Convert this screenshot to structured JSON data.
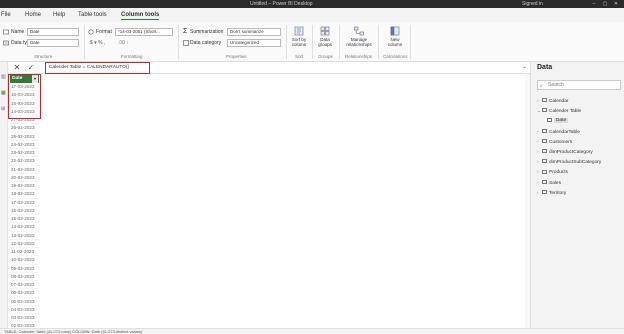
{
  "titlebar": {
    "title": "Untitled – Power BI Desktop",
    "user": "Signed in"
  },
  "menu": {
    "tabs": [
      {
        "label": "File"
      },
      {
        "label": "Home"
      },
      {
        "label": "Help"
      },
      {
        "label": "Table tools"
      },
      {
        "label": "Column tools",
        "active": true
      }
    ]
  },
  "ribbon": {
    "structure": {
      "name_label": "Name",
      "name_value": "Date",
      "datatype_label": "Data type",
      "datatype_value": "Date",
      "group_label": "Structure"
    },
    "formatting": {
      "format_label": "Format",
      "format_value": "*14-03-2001 (Short...",
      "group_label": "Formatting"
    },
    "properties": {
      "summarization_label": "Summarization",
      "summarization_value": "Don't summarize",
      "category_label": "Data category",
      "category_value": "Uncategorized",
      "group_label": "Properties"
    },
    "sort": {
      "label1": "Sort by",
      "label2": "column",
      "group_label": "Sort"
    },
    "groups": {
      "label1": "Data",
      "label2": "groups",
      "group_label": "Groups"
    },
    "relationships": {
      "label1": "Manage",
      "label2": "relationships",
      "group_label": "Relationships"
    },
    "calculations": {
      "label1": "New",
      "label2": "column",
      "group_label": "Calculations"
    }
  },
  "formula_bar": {
    "formula": "Calender Table = CALENDARAUTO()"
  },
  "grid": {
    "column_header": "Date",
    "rows": [
      "17-03-2023",
      "16-03-2023",
      "15-03-2023",
      "14-03-2023",
      "27-02-2023",
      "26-02-2023",
      "25-02-2023",
      "24-02-2023",
      "23-02-2023",
      "22-02-2023",
      "21-02-2023",
      "20-02-2023",
      "19-02-2023",
      "18-02-2023",
      "17-02-2023",
      "16-02-2023",
      "15-02-2023",
      "14-02-2023",
      "13-02-2023",
      "12-02-2023",
      "11-02-2023",
      "10-02-2023",
      "09-02-2023",
      "08-02-2023",
      "07-02-2023",
      "06-02-2023",
      "05-02-2023",
      "04-02-2023",
      "03-02-2023",
      "02-02-2023"
    ]
  },
  "datapane": {
    "title": "Data",
    "search_placeholder": "Search",
    "items": [
      {
        "label": "Calendar",
        "type": "table",
        "expanded": false
      },
      {
        "label": "Calender Table",
        "type": "table",
        "expanded": true
      },
      {
        "label": "Date",
        "type": "field",
        "selected": true
      },
      {
        "label": "CalendarTable",
        "type": "table",
        "expanded": false
      },
      {
        "label": "Customers",
        "type": "table",
        "expanded": false
      },
      {
        "label": "dimProductCategory",
        "type": "table",
        "expanded": false
      },
      {
        "label": "dimProductSubCategory",
        "type": "table",
        "expanded": false
      },
      {
        "label": "Products",
        "type": "table",
        "expanded": false
      },
      {
        "label": "Sales",
        "type": "table",
        "expanded": false
      },
      {
        "label": "Territory",
        "type": "table",
        "expanded": false
      }
    ]
  },
  "statusbar": {
    "text": "TABLE: Calender Table (41,273 rows) COLUMN: Date (41,273 distinct values)"
  },
  "colors": {
    "accent": "#2f7a3c",
    "highlight": "#d0202a"
  }
}
